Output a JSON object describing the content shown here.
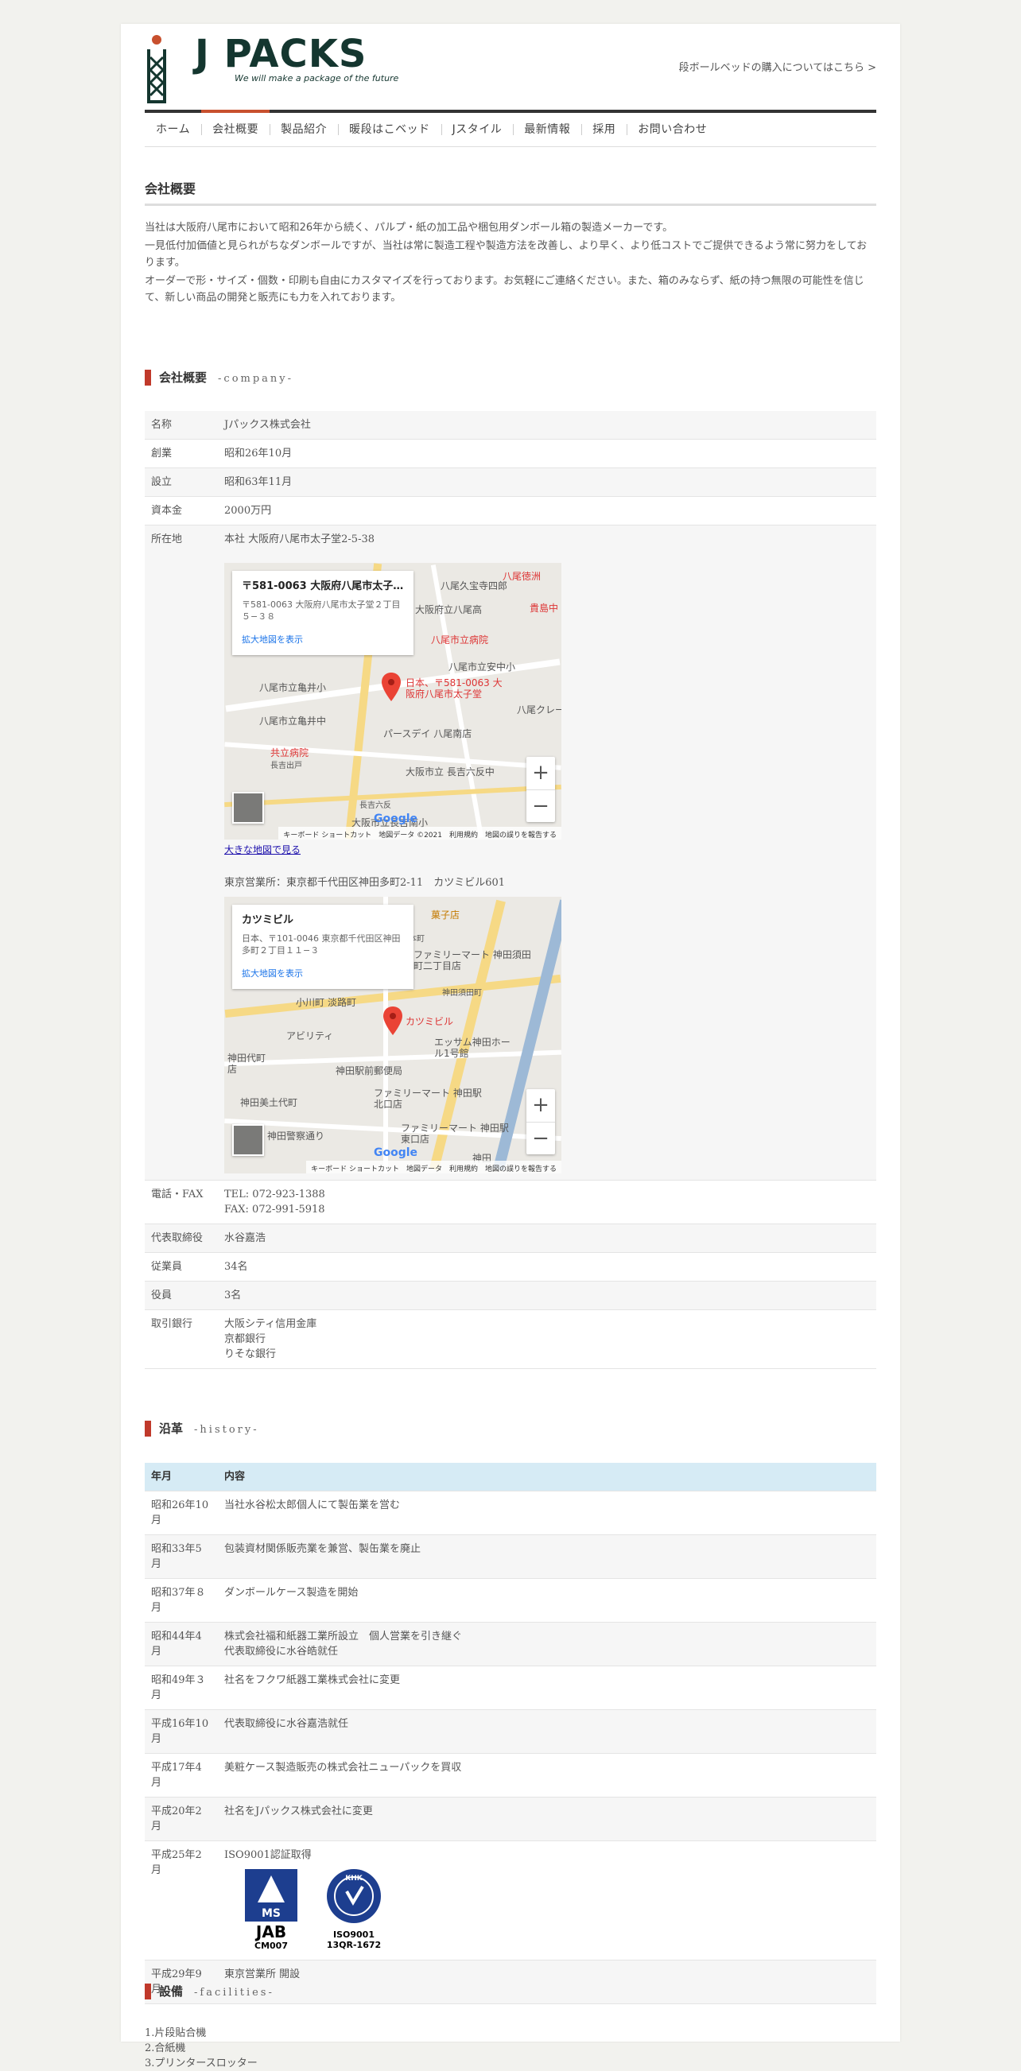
{
  "header": {
    "logo_text": "J PACKS",
    "logo_tagline": "We will make a package of the future",
    "top_link": "段ボールベッドの購入についてはこちら >"
  },
  "nav": [
    "ホーム",
    "会社概要",
    "製品紹介",
    "暖段はこベッド",
    "Jスタイル",
    "最新情報",
    "採用",
    "お問い合わせ"
  ],
  "page_title": "会社概要",
  "intro": [
    "当社は大阪府八尾市において昭和26年から続く、パルプ・紙の加工品や梱包用ダンボール箱の製造メーカーです。",
    "一見低付加価値と見られがちなダンボールですが、当社は常に製造工程や製造方法を改善し、より早く、より低コストでご提供できるよう常に努力をしております。",
    "オーダーで形・サイズ・個数・印刷も自由にカスタマイズを行っております。お気軽にご連絡ください。また、箱のみならず、紙の持つ無限の可能性を信じて、新しい商品の開発と販売にも力を入れております。"
  ],
  "company_section": {
    "title": "会社概要",
    "sub": "-company-"
  },
  "company": [
    {
      "k": "名称",
      "v": "Jパックス株式会社"
    },
    {
      "k": "創業",
      "v": "昭和26年10月"
    },
    {
      "k": "設立",
      "v": "昭和63年11月"
    },
    {
      "k": "資本金",
      "v": "2000万円"
    }
  ],
  "address": {
    "k": "所在地",
    "head_office": "本社 大阪府八尾市太子堂2-5-38",
    "map1": {
      "card_title": "〒581-0063 大阪府八尾市太子…",
      "card_addr": "〒581-0063 大阪府八尾市太子堂２丁目５−３８",
      "card_link": "拡大地図を表示",
      "pin_label": "日本、〒581-0063 大阪府八尾市太子堂",
      "poi": [
        "八尾久宝寺四郎",
        "大阪府立八尾高",
        "八尾市立病院",
        "八尾市立安中小",
        "八尾市立亀井小",
        "八尾市立亀井中",
        "パースデイ 八尾南店",
        "共立病院",
        "長吉出戸",
        "大阪市立 長吉六反中",
        "長吉六反",
        "大阪市立長吉南小",
        "八尾徳洲",
        "貴島中",
        "八尾クレーン"
      ],
      "footer": "キーボード ショートカット　地図データ ©2021　利用規約　地図の誤りを報告する"
    },
    "map1_link": "大きな地図で見る",
    "tokyo_office": "東京営業所：東京都千代田区神田多町2-11　カツミビル601",
    "map2": {
      "card_title": "カツミビル",
      "card_addr": "日本、〒101-0046 東京都千代田区神田多町２丁目１１−３",
      "card_link": "拡大地図を表示",
      "pin_label": "カツミビル",
      "poi": [
        "菓子店",
        "ファミリーマート 神田須田町二丁目店",
        "小川町",
        "淡路町",
        "アビリティ",
        "エッサム神田ホール1号館",
        "神田駅前郵便局",
        "ファミリーマート 神田駅北口店",
        "神田美土代町",
        "神田警察通り",
        "ファミリーマート 神田駅東口店",
        "神田",
        "岩本町",
        "神田須田町",
        "神田代町店"
      ],
      "footer": "キーボード ショートカット　地図データ　利用規約　地図の誤りを報告する"
    }
  },
  "company2": [
    {
      "k": "電話・FAX",
      "v": [
        "TEL: 072-923-1388",
        "FAX: 072-991-5918"
      ]
    },
    {
      "k": "代表取締役",
      "v": [
        "水谷嘉浩"
      ]
    },
    {
      "k": "従業員",
      "v": [
        "34名"
      ]
    },
    {
      "k": "役員",
      "v": [
        "3名"
      ]
    },
    {
      "k": "取引銀行",
      "v": [
        "大阪シティ信用金庫",
        "京都銀行",
        "りそな銀行"
      ]
    }
  ],
  "history_section": {
    "title": "沿革",
    "sub": "-history-"
  },
  "history_header": {
    "k": "年月",
    "v": "内容"
  },
  "history": [
    {
      "k": "昭和26年10月",
      "v": [
        "当社水谷松太郎個人にて製缶業を営む"
      ]
    },
    {
      "k": "昭和33年5月",
      "v": [
        "包装資材関係販売業を兼営、製缶業を廃止"
      ]
    },
    {
      "k": "昭和37年８月",
      "v": [
        "ダンボールケース製造を開始"
      ]
    },
    {
      "k": "昭和44年4月",
      "v": [
        "株式会社福和紙器工業所設立　個人営業を引き継ぐ",
        "代表取締役に水谷皓就任"
      ]
    },
    {
      "k": "昭和49年３月",
      "v": [
        "社名をフクワ紙器工業株式会社に変更"
      ]
    },
    {
      "k": "平成16年10月",
      "v": [
        "代表取締役に水谷嘉浩就任"
      ]
    },
    {
      "k": "平成17年4月",
      "v": [
        "美粧ケース製造販売の株式会社ニューパックを買収"
      ]
    },
    {
      "k": "平成20年2月",
      "v": [
        "社名をJパックス株式会社に変更"
      ]
    },
    {
      "k": "平成25年2月",
      "v": [
        "ISO9001認証取得"
      ]
    },
    {
      "k": "平成29年9月",
      "v": [
        "東京営業所 開設"
      ]
    }
  ],
  "certs": {
    "jab": {
      "top": "MS",
      "main": "JAB",
      "code": "CM007"
    },
    "khk": {
      "top": "KHK",
      "main": "ISO9001",
      "code": "13QR-1672"
    }
  },
  "facilities_section": {
    "title": "設備",
    "sub": "-facilities-"
  },
  "facilities": [
    "1.片段貼合機",
    "2.合紙機",
    "3.プリンタースロッター"
  ]
}
